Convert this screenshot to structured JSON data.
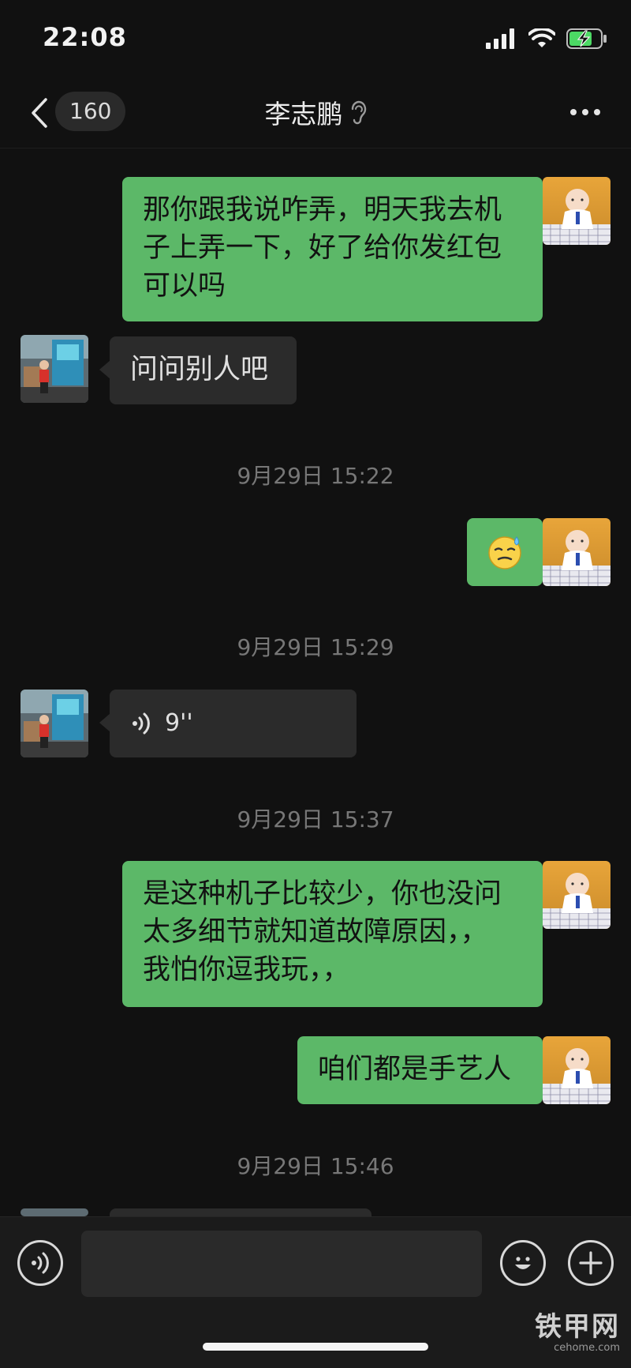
{
  "status_bar": {
    "time": "22:08"
  },
  "header": {
    "unread_count": "160",
    "title": "李志鹏",
    "icons": {
      "back": "chevron-left-icon",
      "ear": "ear-icon",
      "more": "more-dots-icon"
    }
  },
  "messages": [
    {
      "side": "me",
      "text_lines": [
        "那你跟我说咋弄，明天我去机",
        "子上弄一下，好了给你发红包",
        "可以吗"
      ]
    },
    {
      "side": "other",
      "text": "问问别人吧"
    },
    {
      "timestamp": "9月29日 15:22"
    },
    {
      "side": "me",
      "emoji": "sweat-smile-emoji"
    },
    {
      "timestamp": "9月29日 15:29"
    },
    {
      "side": "other",
      "voice_duration": "9''"
    },
    {
      "timestamp": "9月29日 15:37"
    },
    {
      "side": "me",
      "text_lines": [
        "是这种机子比较少，你也没问",
        "太多细节就知道故障原因，，",
        "我怕你逗我玩，，"
      ]
    },
    {
      "side": "me",
      "text": "咱们都是手艺人"
    },
    {
      "timestamp": "9月29日 15:46"
    }
  ],
  "input_bar": {
    "value": "",
    "icons": {
      "voice": "voice-icon",
      "emoji": "emoji-icon",
      "add": "plus-icon"
    }
  },
  "watermark": {
    "main": "铁甲网",
    "sub": "cehome.com"
  },
  "colors": {
    "background": "#111111",
    "my_bubble": "#5cb868",
    "other_bubble": "#2b2b2b",
    "timestamp": "#777777"
  }
}
